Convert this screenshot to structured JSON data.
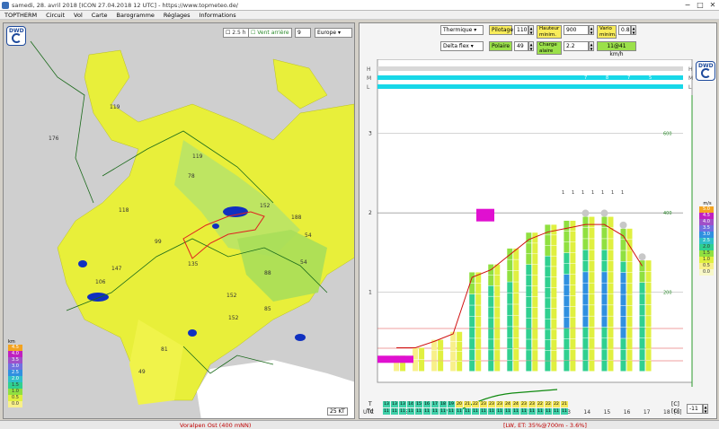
{
  "window": {
    "title": "samedi, 28. avril 2018 [ICON 27.04.2018 12 UTC] - https://www.topmeteo.de/",
    "buttons": [
      "−",
      "□",
      "✕"
    ]
  },
  "menu": [
    "TOPTHERM",
    "Circuit",
    "Vol",
    "Carte",
    "Barogramme",
    "Réglages",
    "Informations"
  ],
  "map": {
    "time_label": "2.5 h",
    "wind_checkbox": "Vent arrière",
    "level_value": "9",
    "region_value": "Europe",
    "wind_scale": "25 KT",
    "legend_unit": "km",
    "legend_values": [
      "4.5",
      "4.0",
      "3.5",
      "3.0",
      "2.5",
      "2.0",
      "1.5",
      "1.0",
      "0.5",
      "0.0"
    ],
    "legend_colors": [
      "#f3a321",
      "#c020c0",
      "#a050c8",
      "#7070e0",
      "#3090e0",
      "#30c0c8",
      "#30d090",
      "#90e040",
      "#e0f040",
      "#f8f08a"
    ],
    "contour_labels": [
      "119",
      "176",
      "119",
      "78",
      "118",
      "152",
      "99",
      "188",
      "54",
      "135",
      "152",
      "88",
      "54",
      "147",
      "106",
      "152",
      "85",
      "81",
      "49"
    ],
    "logo": "DWD"
  },
  "controls": {
    "aircraft_type": "Thermique",
    "aircraft_model": "Delta flex",
    "pilotage_label": "Pilotage",
    "pilotage_value": "110",
    "polaire_label": "Polaire",
    "polaire_value": "49",
    "hauteur_label": "Hauteur minim.",
    "hauteur_value": "900",
    "charge_label": "Charge alaire",
    "charge_value": "2.2",
    "vario_label": "Vario minim.",
    "vario_value": "0.8",
    "speed_value": "11@41 km/h"
  },
  "chart_data": {
    "type": "bar",
    "title": "",
    "x_axis_label": "UTC",
    "hours": [
      "4",
      "5",
      "6",
      "7",
      "8",
      "9",
      "10",
      "11",
      "12",
      "13",
      "14",
      "15",
      "16",
      "17",
      "18"
    ],
    "hours_unit": "[h]",
    "y_left_ticks": [
      "1",
      "2",
      "3"
    ],
    "y_right_ticks": [
      "200",
      "400",
      "600"
    ],
    "cloud_rows": [
      "H",
      "M",
      "L"
    ],
    "cloud_m_values": [
      "7",
      "8",
      "7",
      "5"
    ],
    "thermal_top_km": [
      0.2,
      0.3,
      0.4,
      0.5,
      1.25,
      1.35,
      1.55,
      1.75,
      1.85,
      1.9,
      1.95,
      1.95,
      1.8,
      1.4
    ],
    "legend_unit": "m/s",
    "legend_values": [
      "5.0",
      "4.5",
      "4.0",
      "3.5",
      "3.0",
      "2.5",
      "2.0",
      "1.5",
      "1.0",
      "0.5",
      "0.0"
    ],
    "legend_colors": [
      "#f3a321",
      "#c020c0",
      "#a050c8",
      "#7070e0",
      "#3090e0",
      "#30c0c8",
      "#30d090",
      "#90e040",
      "#e0f040",
      "#f8f08a",
      "#f8f8c8"
    ],
    "temp_row_label": "T",
    "dew_row_label": "Td",
    "temp_values": [
      "13",
      "13",
      "13",
      "14",
      "15",
      "16",
      "17",
      "18",
      "19",
      "20",
      "21",
      "22",
      "23",
      "23",
      "23",
      "24",
      "24",
      "23",
      "23",
      "22",
      "22",
      "22",
      "21"
    ],
    "dew_values": [
      "11",
      "11",
      "11",
      "11",
      "11",
      "11",
      "11",
      "11",
      "11",
      "11",
      "11",
      "11",
      "11",
      "11",
      "11",
      "11",
      "11",
      "11",
      "11",
      "11",
      "11",
      "11",
      "11"
    ],
    "temp_unit": "[C]",
    "offset_value": "-11",
    "top_labels": [
      "1",
      "1",
      "1",
      "1",
      "1",
      "1",
      "1"
    ],
    "logo": "DWD"
  },
  "status": {
    "left": "Voralpen Ost (400 mNN)",
    "right": "[LW, ET: 35%@700m - 3.6%]"
  }
}
